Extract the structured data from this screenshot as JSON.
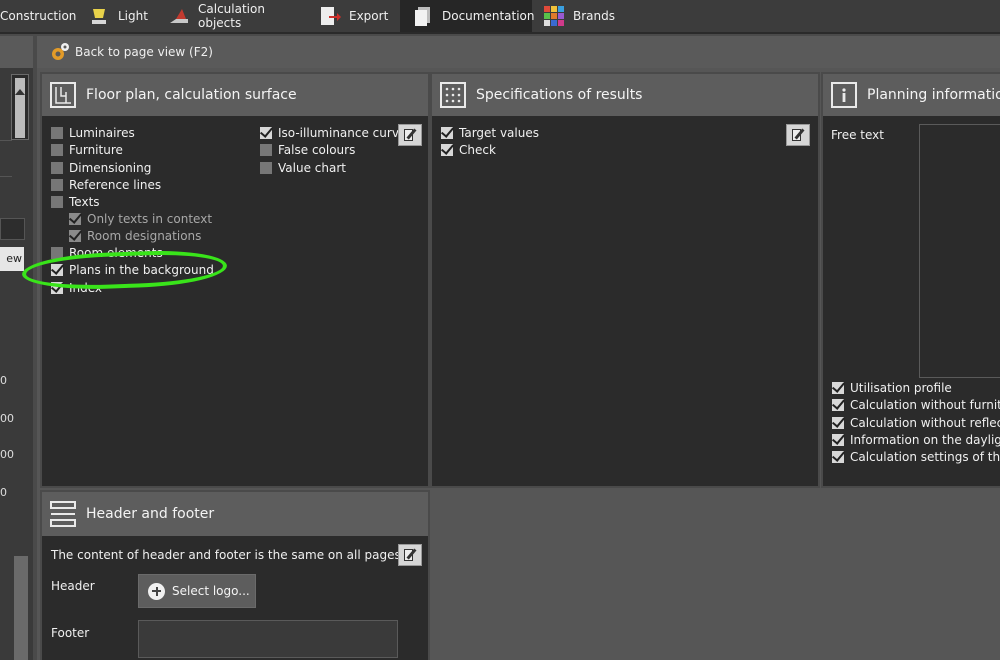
{
  "menu": {
    "tabs": [
      {
        "label": "Construction",
        "icon": "construction-icon"
      },
      {
        "label": "Light",
        "icon": "lamp-icon"
      },
      {
        "label": "Calculation objects",
        "icon": "calculation-objects-icon"
      },
      {
        "label": "Export",
        "icon": "export-icon"
      },
      {
        "label": "Documentation",
        "icon": "documentation-icon",
        "active": true
      },
      {
        "label": "Brands",
        "icon": "brands-icon"
      }
    ]
  },
  "sidebar": {
    "button_label": "ew",
    "numbers": [
      "0",
      "00",
      "00",
      "0"
    ]
  },
  "back": {
    "label": "Back to page view (F2)"
  },
  "floorplan": {
    "title": "Floor plan, calculation surface",
    "items": [
      {
        "label": "Luminaires",
        "checked": false
      },
      {
        "label": "Furniture",
        "checked": false
      },
      {
        "label": "Dimensioning",
        "checked": false
      },
      {
        "label": "Reference lines",
        "checked": false
      },
      {
        "label": "Texts",
        "checked": false
      },
      {
        "label": "Only texts in context",
        "checked": true,
        "sub": true
      },
      {
        "label": "Room designations",
        "checked": true,
        "sub": true
      },
      {
        "label": "Room elements",
        "checked": false
      },
      {
        "label": "Plans in the background",
        "checked": true
      },
      {
        "label": "Index",
        "checked": true
      }
    ],
    "items_right": [
      {
        "label": "Iso-illuminance curves",
        "checked": true
      },
      {
        "label": "False colours",
        "checked": false
      },
      {
        "label": "Value chart",
        "checked": false
      }
    ]
  },
  "specs": {
    "title": "Specifications of results",
    "items": [
      {
        "label": "Target values",
        "checked": true
      },
      {
        "label": "Check",
        "checked": true
      }
    ]
  },
  "planning": {
    "title": "Planning information",
    "free_text_label": "Free text",
    "items": [
      {
        "label": "Utilisation profile",
        "checked": true
      },
      {
        "label": "Calculation without furniture",
        "checked": true
      },
      {
        "label": "Calculation without reflection",
        "checked": true
      },
      {
        "label": "Information on the daylight",
        "checked": true
      },
      {
        "label": "Calculation settings of the en",
        "checked": true
      }
    ]
  },
  "headerfooter": {
    "title": "Header and footer",
    "note": "The content of header and footer is the same on all pages.",
    "header_label": "Header",
    "select_logo": "Select logo...",
    "footer_label": "Footer",
    "footer_value": ""
  },
  "colors": {
    "highlight": "#39e41a",
    "panel_bg": "#2b2b2b",
    "header_bg": "#5d5d5d"
  }
}
